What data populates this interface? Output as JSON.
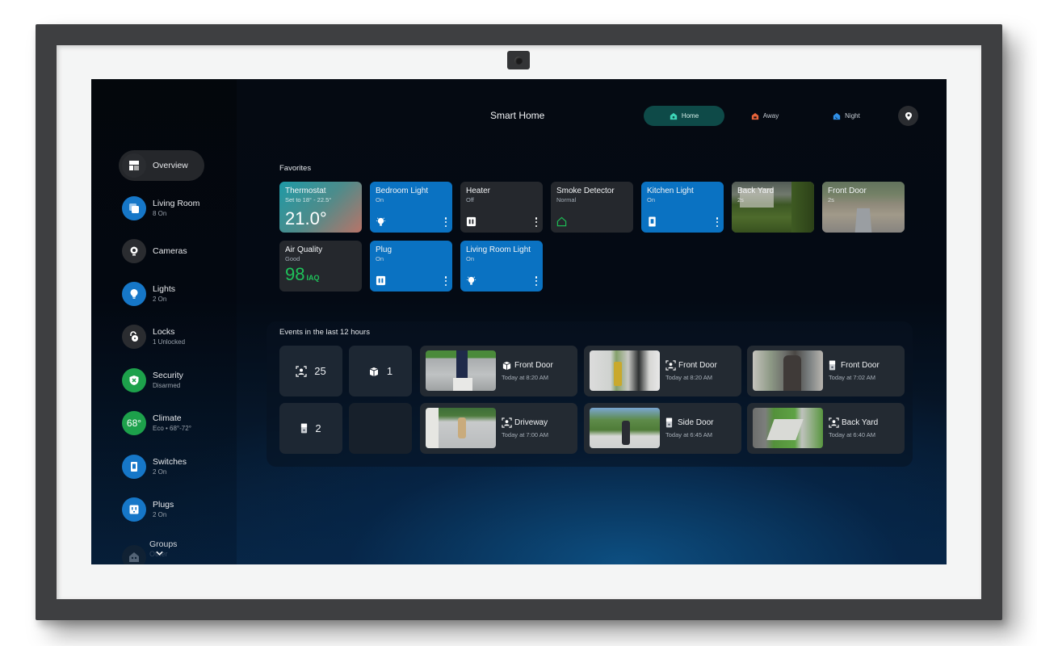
{
  "device": {
    "frame_color": "#3e3f41",
    "mat_color": "#f4f5f5"
  },
  "header": {
    "title": "Smart Home",
    "modes": [
      {
        "label": "Home",
        "icon": "home-shield-icon",
        "active": true,
        "color": "#3dd6b8"
      },
      {
        "label": "Away",
        "icon": "away-house-icon",
        "active": false,
        "color": "#e8643a"
      },
      {
        "label": "Night",
        "icon": "night-house-icon",
        "active": false,
        "color": "#2f8fe6"
      }
    ],
    "location_icon": "location-pin-icon"
  },
  "sidebar": {
    "items": [
      {
        "label": "Overview",
        "sub": "",
        "icon": "overview-grid-icon",
        "active": true
      },
      {
        "label": "Living Room",
        "sub": "8 On",
        "icon": "room-icon"
      },
      {
        "label": "Cameras",
        "sub": "",
        "icon": "camera-icon"
      },
      {
        "label": "Lights",
        "sub": "2 On",
        "icon": "bulb-icon"
      },
      {
        "label": "Locks",
        "sub": "1 Unlocked",
        "icon": "unlocked-icon"
      },
      {
        "label": "Security",
        "sub": "Disarmed",
        "icon": "shield-x-icon"
      },
      {
        "label": "Climate",
        "sub": "Eco • 68°-72°",
        "icon_text": "68°"
      },
      {
        "label": "Switches",
        "sub": "2 On",
        "icon": "switch-icon"
      },
      {
        "label": "Plugs",
        "sub": "2 On",
        "icon": "plug-icon"
      },
      {
        "label": "Groups",
        "sub": "Other",
        "icon": "groups-house-icon"
      }
    ],
    "expand_icon": "chevron-down-icon"
  },
  "favorites": {
    "title": "Favorites",
    "tiles": [
      {
        "name": "Thermostat",
        "status": "Set to 18° - 22.5°",
        "value": "21.0°"
      },
      {
        "name": "Bedroom Light",
        "status": "On"
      },
      {
        "name": "Heater",
        "status": "Off"
      },
      {
        "name": "Smoke Detector",
        "status": "Normal"
      },
      {
        "name": "Kitchen Light",
        "status": "On"
      },
      {
        "name": "Back Yard",
        "status": "2s"
      },
      {
        "name": "Front Door",
        "status": "2s"
      },
      {
        "name": "Air Quality",
        "status": "Good",
        "value": "98",
        "unit": "IAQ"
      },
      {
        "name": "Plug",
        "status": "On"
      },
      {
        "name": "Living Room Light",
        "status": "On"
      }
    ]
  },
  "events": {
    "title": "Events in the last 12 hours",
    "counts": [
      {
        "icon": "person-detect-icon",
        "count": "25"
      },
      {
        "icon": "package-icon",
        "count": "1"
      },
      {
        "icon": "doorbell-icon",
        "count": "2"
      }
    ],
    "items": [
      {
        "title": "Front Door",
        "time": "Today at 8:20 AM",
        "icon": "package-icon"
      },
      {
        "title": "Front Door",
        "time": "Today at 8:20 AM",
        "icon": "person-detect-icon"
      },
      {
        "title": "Front Door",
        "time": "Today at 7:02 AM",
        "icon": "doorbell-icon"
      },
      {
        "title": "Driveway",
        "time": "Today at 7:00 AM",
        "icon": "person-detect-icon"
      },
      {
        "title": "Side Door",
        "time": "Today at 6:45 AM",
        "icon": "doorbell-icon"
      },
      {
        "title": "Back Yard",
        "time": "Today at 6:40 AM",
        "icon": "person-detect-icon"
      }
    ]
  }
}
